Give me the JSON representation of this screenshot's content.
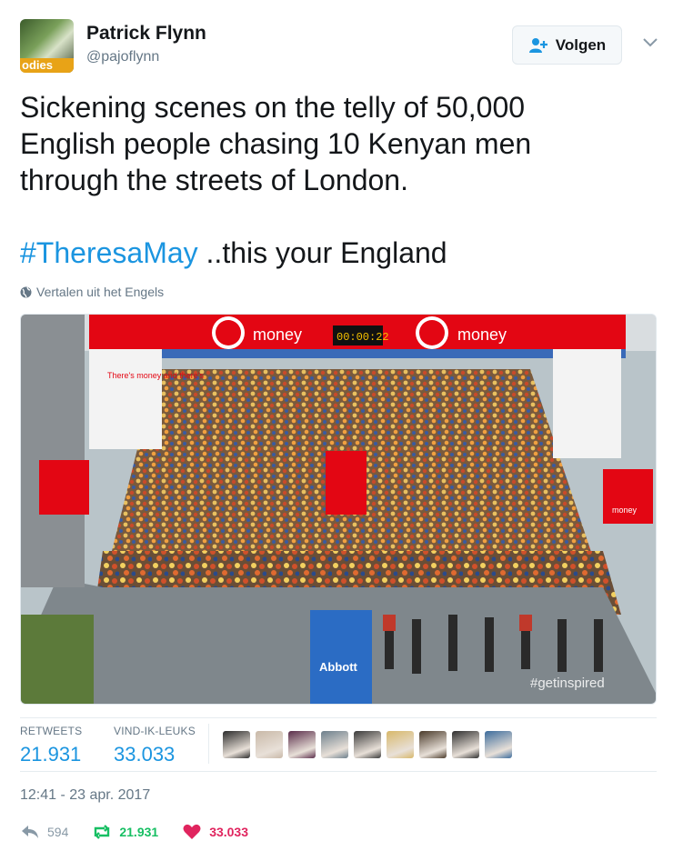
{
  "author": {
    "name": "Patrick Flynn",
    "handle": "@pajoflynn",
    "avatar_text": "odies"
  },
  "follow_button": {
    "label": "Volgen",
    "icon": "add-user-icon"
  },
  "menu_icon": "chevron-down-icon",
  "tweet": {
    "line1": "Sickening scenes on the telly of 50,000",
    "line2": "English people chasing 10 Kenyan men",
    "line3": "through the streets of London.",
    "hashtag": "#TheresaMay",
    "after_hashtag": " ..this your England"
  },
  "translate": {
    "label": "Vertalen uit het Engels",
    "icon": "globe-icon"
  },
  "photo": {
    "brand": "money",
    "clock": "00:00:22",
    "sponsor": "Abbott",
    "tag": "#getinspired",
    "banner_text": "There's money and there's",
    "small_banner": "money"
  },
  "stats": {
    "retweets_label": "RETWEETS",
    "retweets_value": "21.931",
    "likes_label": "VIND-IK-LEUKS",
    "likes_value": "33.033"
  },
  "likers": [
    "#2b2b2b",
    "#c9b9a8",
    "#5a2d4a",
    "#6c7f8c",
    "#3a3a3a",
    "#d8b86a",
    "#4a3a2a",
    "#2e2e2e",
    "#3c6c9c"
  ],
  "timestamp": "12:41 - 23 apr. 2017",
  "actions": {
    "reply_count": "594",
    "retweet_count": "21.931",
    "like_count": "33.033"
  },
  "colors": {
    "link": "#1b95e0",
    "retweet": "#17bf63",
    "like": "#e0245e",
    "muted": "#657786"
  }
}
